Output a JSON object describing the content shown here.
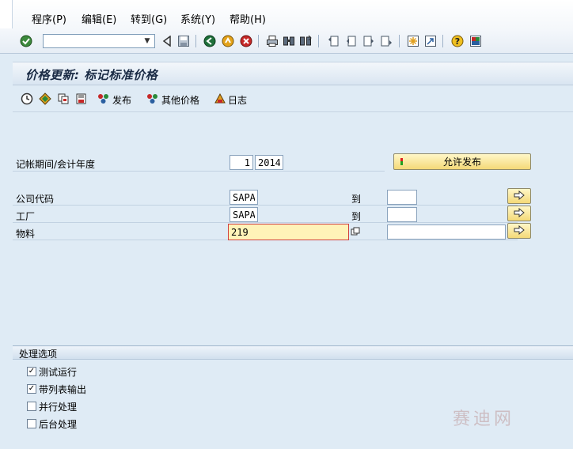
{
  "menu": {
    "items": [
      {
        "label": "程序(P)"
      },
      {
        "label": "编辑(E)"
      },
      {
        "label": "转到(G)"
      },
      {
        "label": "系统(Y)"
      },
      {
        "label": "帮助(H)"
      }
    ]
  },
  "toolbar": {
    "command_value": ""
  },
  "page": {
    "title": "价格更新: 标记标准价格"
  },
  "app_toolbar": {
    "release_label": "发布",
    "other_prices_label": "其他价格",
    "log_label": "日志"
  },
  "form": {
    "period_label": "记帐期间/会计年度",
    "period_value": "1",
    "year_value": "2014",
    "allow_release_label": "允许发布",
    "company_code_label": "公司代码",
    "company_code_from": "SAPA",
    "company_code_to": "",
    "plant_label": "工厂",
    "plant_from": "SAPA",
    "plant_to": "",
    "material_label": "物料",
    "material_from": "219",
    "material_to": "",
    "to_label": "到"
  },
  "processing": {
    "title": "处理选项",
    "options": [
      {
        "label": "测试运行",
        "checked": true
      },
      {
        "label": "带列表输出",
        "checked": true
      },
      {
        "label": "并行处理",
        "checked": false
      },
      {
        "label": "后台处理",
        "checked": false
      }
    ]
  },
  "watermark": "赛迪网",
  "colors": {
    "background": "#dfebf5",
    "button_yellow": "#f4d978",
    "focus_field": "#fff3b8"
  }
}
